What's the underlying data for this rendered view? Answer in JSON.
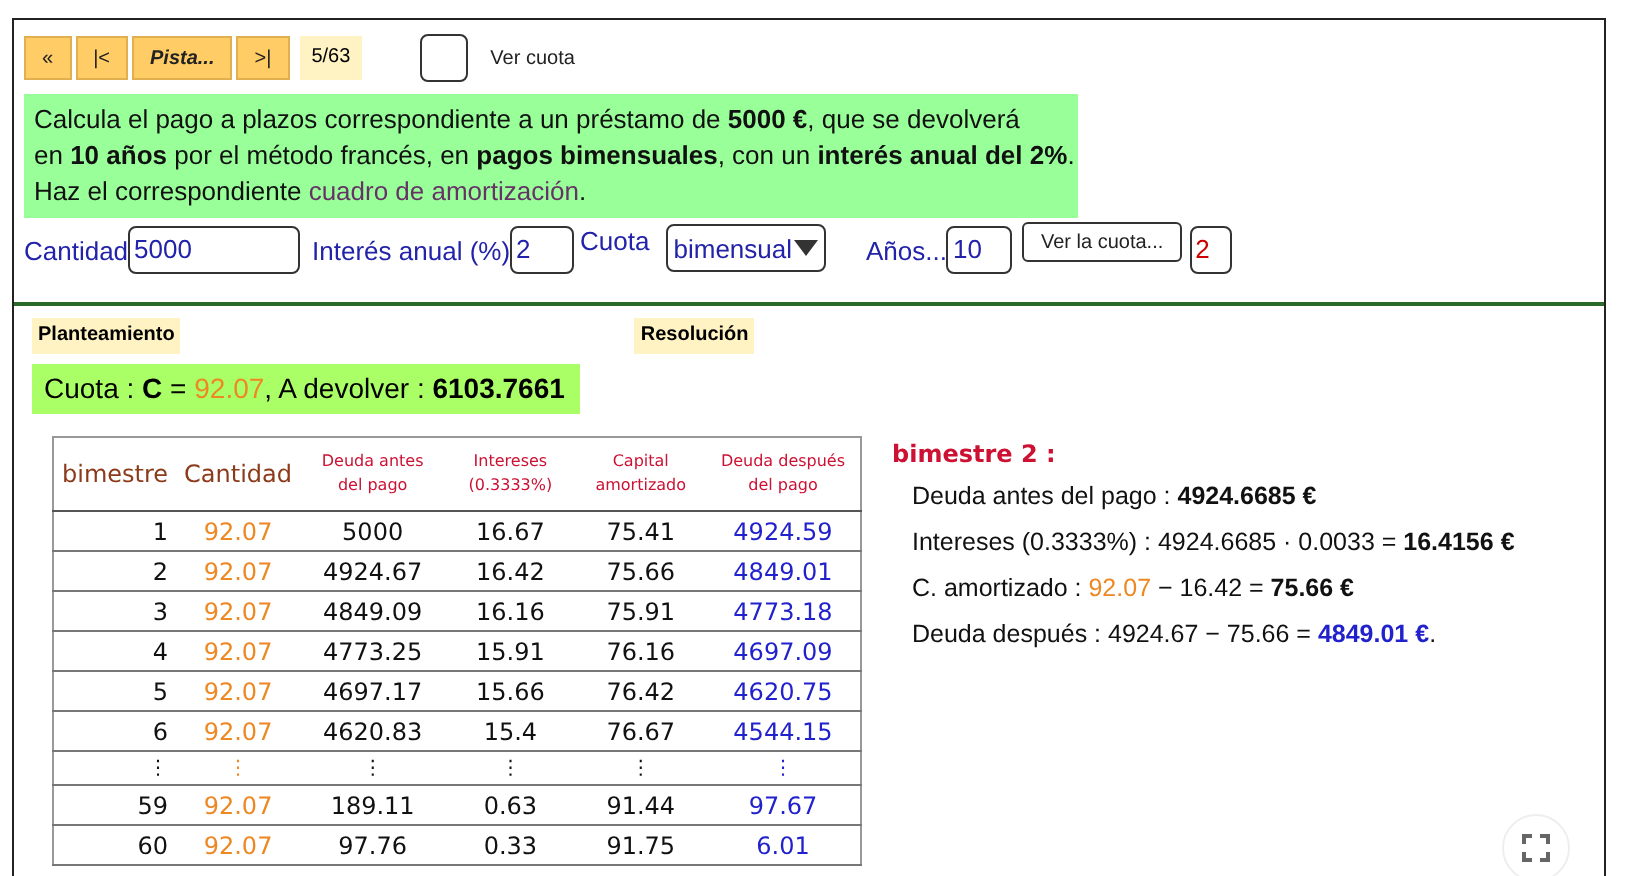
{
  "toolbar": {
    "buttons": [
      {
        "label": "«",
        "italic": false
      },
      {
        "label": "|<",
        "italic": false
      },
      {
        "label": "Pista...",
        "italic": true
      },
      {
        "label": ">|",
        "italic": false
      }
    ],
    "counter": "5/63",
    "show_quota": {
      "checked": false,
      "label": "Ver cuota"
    }
  },
  "statement": [
    [
      {
        "kind": "plain",
        "text": "Calcula el pago a plazos correspondiente a un préstamo de "
      },
      {
        "kind": "bold",
        "text": "5000 €"
      },
      {
        "kind": "plain",
        "text": ", que se devolverá"
      }
    ],
    [
      {
        "kind": "plain",
        "text": "en "
      },
      {
        "kind": "bold",
        "text": "10 años"
      },
      {
        "kind": "plain",
        "text": " por el método francés, en "
      },
      {
        "kind": "bold",
        "text": "pagos bimensuales"
      },
      {
        "kind": "plain",
        "text": ", con un "
      },
      {
        "kind": "bold",
        "text": "interés anual del 2%"
      },
      {
        "kind": "plain",
        "text": "."
      }
    ],
    [
      {
        "kind": "plain",
        "text": "Haz el correspondiente "
      },
      {
        "kind": "link",
        "text": "cuadro de amortización"
      },
      {
        "kind": "plain",
        "text": "."
      }
    ]
  ],
  "inputs": {
    "amount_label": "Cantidad",
    "amount": "5000",
    "rate_label": "Interés anual (%)",
    "rate": "2",
    "quota_label": "Cuota",
    "quota_period": "bimensual",
    "years_label": "Años...",
    "years": "10",
    "show_button": "Ver la cuota...",
    "step": "2"
  },
  "tabs": [
    {
      "label": "Planteamiento"
    },
    {
      "label": "Resolución"
    }
  ],
  "summary": [
    {
      "kind": "plain",
      "text": "Cuota : "
    },
    {
      "kind": "bold",
      "text": "C"
    },
    {
      "kind": "plain",
      "text": " = "
    },
    {
      "kind": "orange",
      "text": "92.07"
    },
    {
      "kind": "plain",
      "text": ",   A devolver : "
    },
    {
      "kind": "bold",
      "text": "6103.7661"
    }
  ],
  "table": {
    "columns": [
      {
        "label": "bimestre",
        "kind": "main"
      },
      {
        "label": "Cantidad",
        "kind": "main"
      },
      {
        "label": "Deuda antes del pago",
        "kind": "small"
      },
      {
        "label": "Intereses (0.3333%)",
        "kind": "small"
      },
      {
        "label": "Capital amortizado",
        "kind": "small"
      },
      {
        "label": "Deuda después del pago",
        "kind": "small"
      }
    ],
    "rows": [
      {
        "kind": "data",
        "cells": [
          "1",
          "92.07",
          "5000",
          "16.67",
          "75.41",
          "4924.59"
        ]
      },
      {
        "kind": "data",
        "cells": [
          "2",
          "92.07",
          "4924.67",
          "16.42",
          "75.66",
          "4849.01"
        ]
      },
      {
        "kind": "data",
        "cells": [
          "3",
          "92.07",
          "4849.09",
          "16.16",
          "75.91",
          "4773.18"
        ]
      },
      {
        "kind": "data",
        "cells": [
          "4",
          "92.07",
          "4773.25",
          "15.91",
          "76.16",
          "4697.09"
        ]
      },
      {
        "kind": "data",
        "cells": [
          "5",
          "92.07",
          "4697.17",
          "15.66",
          "76.42",
          "4620.75"
        ]
      },
      {
        "kind": "data",
        "cells": [
          "6",
          "92.07",
          "4620.83",
          "15.4",
          "76.67",
          "4544.15"
        ]
      },
      {
        "kind": "gap",
        "cells": [
          "⋮",
          "⋮",
          "⋮",
          "⋮",
          "⋮",
          "⋮"
        ]
      },
      {
        "kind": "data",
        "cells": [
          "59",
          "92.07",
          "189.11",
          "0.63",
          "91.44",
          "97.67"
        ]
      },
      {
        "kind": "data",
        "cells": [
          "60",
          "92.07",
          "97.76",
          "0.33",
          "91.75",
          "6.01"
        ]
      }
    ]
  },
  "detail": {
    "title": "bimestre 2 :",
    "lines": [
      [
        {
          "kind": "plain",
          "text": "Deuda antes del pago :  "
        },
        {
          "kind": "bold",
          "text": "4924.6685 €"
        }
      ],
      [
        {
          "kind": "plain",
          "text": "Intereses (0.3333%) :  4924.6685 · 0.0033 = "
        },
        {
          "kind": "bold",
          "text": "16.4156 €"
        }
      ],
      [
        {
          "kind": "plain",
          "text": "C. amortizado :  "
        },
        {
          "kind": "orange",
          "text": "92.07"
        },
        {
          "kind": "plain",
          "text": " − 16.42 = "
        },
        {
          "kind": "bold",
          "text": "75.66 €"
        }
      ],
      [
        {
          "kind": "plain",
          "text": "Deuda después :  4924.67 − 75.66 = "
        },
        {
          "kind": "blue",
          "text": "4849.01 €"
        },
        {
          "kind": "plain",
          "text": "."
        }
      ]
    ]
  }
}
